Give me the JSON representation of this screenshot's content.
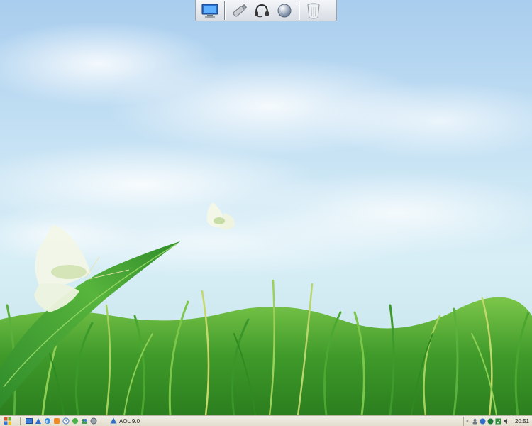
{
  "desktop": {
    "wallpaper": "meadow with butterflies"
  },
  "dock": {
    "groups": [
      {
        "icons": [
          "monitor-icon"
        ]
      },
      {
        "icons": [
          "usb-drive-icon",
          "headset-icon",
          "globe-icon"
        ]
      },
      {
        "icons": [
          "trash-icon"
        ]
      }
    ]
  },
  "taskbar": {
    "start_icon": "start-menu-icon",
    "quick_launch": [
      "show-desktop-icon",
      "aol-icon",
      "ie-icon",
      "media-icon",
      "clock-utility-icon",
      "messenger-icon",
      "contacts-icon",
      "browser-icon"
    ],
    "task": {
      "label": "AOL 9.0",
      "icon": "aol-icon"
    },
    "tray": {
      "icons": [
        "user-icon",
        "network-icon",
        "status-icon",
        "antivirus-icon",
        "volume-icon"
      ],
      "clock": "20:51"
    }
  }
}
